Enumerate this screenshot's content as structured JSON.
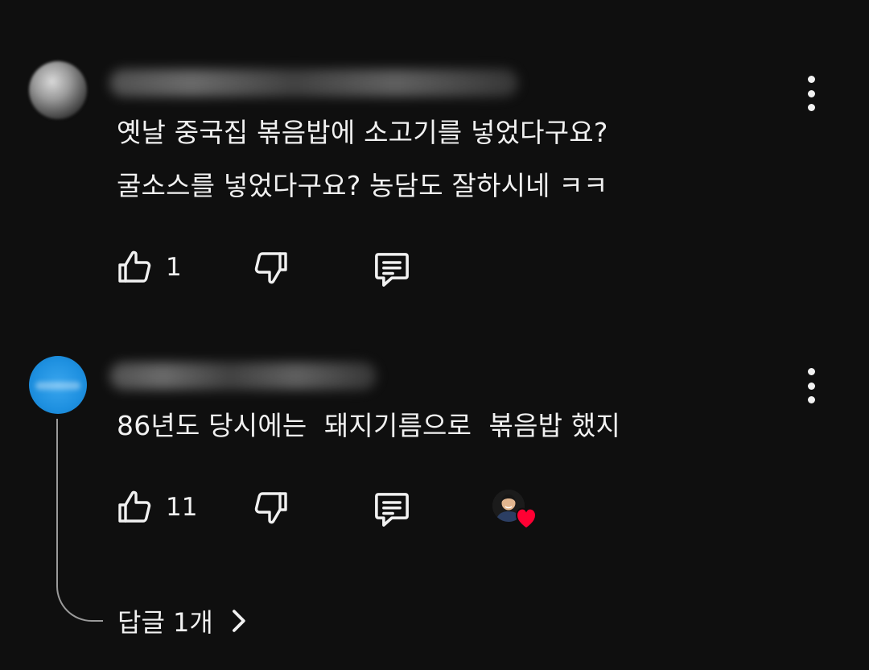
{
  "comments": [
    {
      "text_lines": [
        "옛날 중국집 볶음밥에 소고기를 넣었다구요?",
        "굴소스를 넣었다구요? 농담도 잘하시네 ㅋㅋ"
      ],
      "like_count": "1"
    },
    {
      "text_lines": [
        "86년도 당시에는  돼지기름으로  볶음밥 했지"
      ],
      "like_count": "11",
      "replies_label": "답글 1개"
    }
  ],
  "icons": {
    "menu": "more-vert-icon",
    "like": "thumbs-up-icon",
    "dislike": "thumbs-down-icon",
    "reply": "comment-icon",
    "heart": "heart-icon",
    "chevron": "chevron-right-icon"
  },
  "colors": {
    "background": "#0f0f0f",
    "text": "#f1f1f1",
    "avatar_blue": "#1e90e0",
    "heart_red": "#ff0033"
  }
}
